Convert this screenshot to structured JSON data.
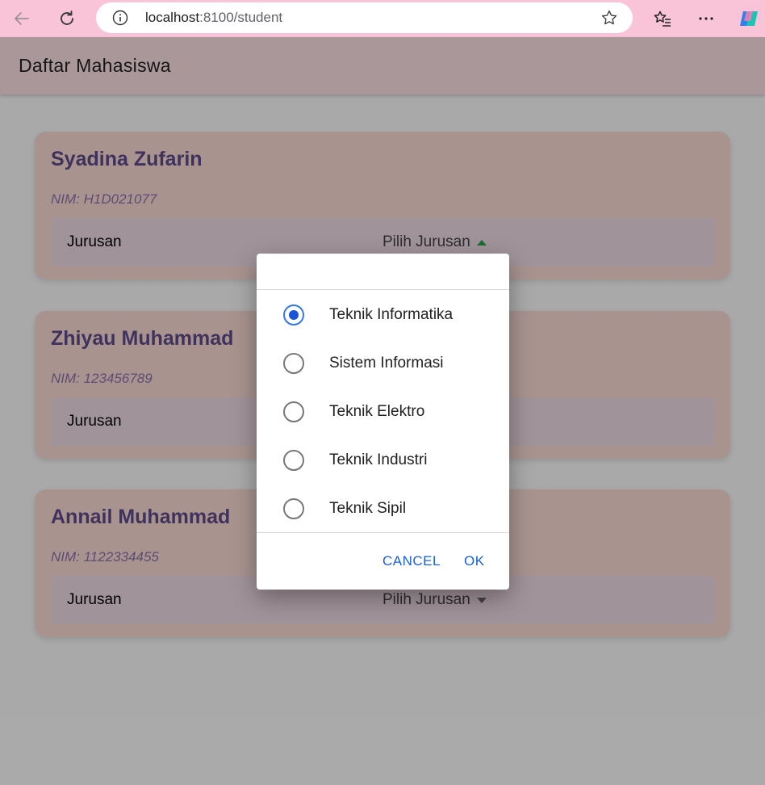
{
  "browser": {
    "url_host": "localhost",
    "url_rest": ":8100/student"
  },
  "page": {
    "title": "Daftar Mahasiswa"
  },
  "students": [
    {
      "name": "Syadina Zufarin",
      "nim": "NIM: H1D021077",
      "field_label": "Jurusan",
      "select_value": "Pilih Jurusan"
    },
    {
      "name": "Zhiyau Muhammad",
      "nim": "NIM: 123456789",
      "field_label": "Jurusan",
      "select_value": ""
    },
    {
      "name": "Annail Muhammad",
      "nim": "NIM: 1122334455",
      "field_label": "Jurusan",
      "select_value": "Pilih Jurusan"
    }
  ],
  "dialog": {
    "options": [
      {
        "label": "Teknik Informatika",
        "checked": true
      },
      {
        "label": "Sistem Informasi",
        "checked": false
      },
      {
        "label": "Teknik Elektro",
        "checked": false
      },
      {
        "label": "Teknik Industri",
        "checked": false
      },
      {
        "label": "Teknik Sipil",
        "checked": false
      }
    ],
    "cancel_label": "CANCEL",
    "ok_label": "OK"
  },
  "colors": {
    "browser_bar": "#f9c4d8",
    "toolbar": "#fde1e6",
    "card": "#fbdcd6",
    "name_text": "#5e4b8a",
    "radio_checked": "#1a55d8",
    "dialog_button": "#1a61d8"
  },
  "icons": [
    "back-arrow-icon",
    "refresh-icon",
    "info-icon",
    "star-icon",
    "favorites-icon",
    "more-icon",
    "copilot-icon"
  ]
}
